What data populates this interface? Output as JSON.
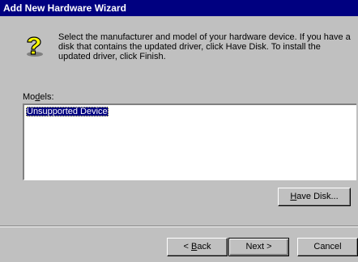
{
  "window": {
    "title": "Add New Hardware Wizard"
  },
  "instructions": "Select the manufacturer and model of your hardware device. If you have a disk that contains the updated driver, click Have Disk. To install the updated driver, click Finish.",
  "models": {
    "label_pre": "Mo",
    "label_accel": "d",
    "label_post": "els:",
    "items": [
      "Unsupported Device"
    ]
  },
  "buttons": {
    "have_disk": {
      "accel": "H",
      "rest": "ave Disk..."
    },
    "back": {
      "pre": "< ",
      "accel": "B",
      "rest": "ack"
    },
    "next": "Next >",
    "cancel": "Cancel"
  },
  "icons": {
    "help": "question-mark-help-icon"
  }
}
